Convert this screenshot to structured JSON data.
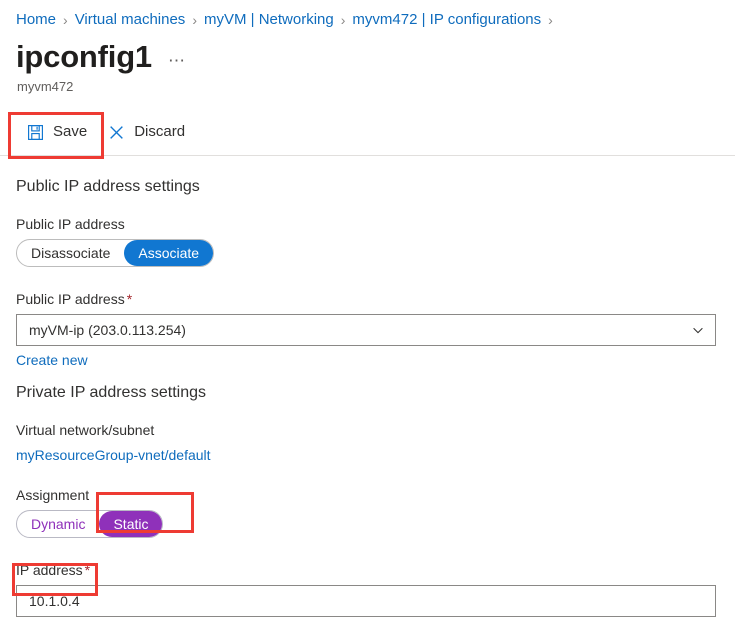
{
  "breadcrumb": {
    "items": [
      {
        "label": "Home"
      },
      {
        "label": "Virtual machines"
      },
      {
        "label": "myVM | Networking"
      },
      {
        "label": "myvm472 | IP configurations"
      }
    ],
    "separator": "›"
  },
  "header": {
    "title": "ipconfig1",
    "more_menu": "⋯",
    "subtitle": "myvm472"
  },
  "commandbar": {
    "save": {
      "label": "Save",
      "icon": "save-floppy-icon"
    },
    "discard": {
      "label": "Discard",
      "icon": "close-x-icon"
    }
  },
  "public_ip": {
    "section_heading": "Public IP address settings",
    "toggle_label": "Public IP address",
    "toggle_options": [
      {
        "label": "Disassociate",
        "selected": false
      },
      {
        "label": "Associate",
        "selected": true
      }
    ],
    "select_label": "Public IP address",
    "required_marker": "*",
    "select_value": "myVM-ip (203.0.113.254)",
    "create_new_link": "Create new"
  },
  "private_ip": {
    "section_heading": "Private IP address settings",
    "vnet_label": "Virtual network/subnet",
    "vnet_value": "myResourceGroup-vnet/default",
    "assignment_label": "Assignment",
    "assignment_options": [
      {
        "label": "Dynamic",
        "selected": false
      },
      {
        "label": "Static",
        "selected": true
      }
    ],
    "ip_label": "IP address",
    "required_marker": "*",
    "ip_value": "10.1.0.4"
  },
  "colors": {
    "link_blue": "#0f6cbd",
    "toggle_blue": "#1177d1",
    "toggle_purple": "#8f31ba",
    "annotation_red": "#ee3b33",
    "required_red": "#a4262c"
  }
}
